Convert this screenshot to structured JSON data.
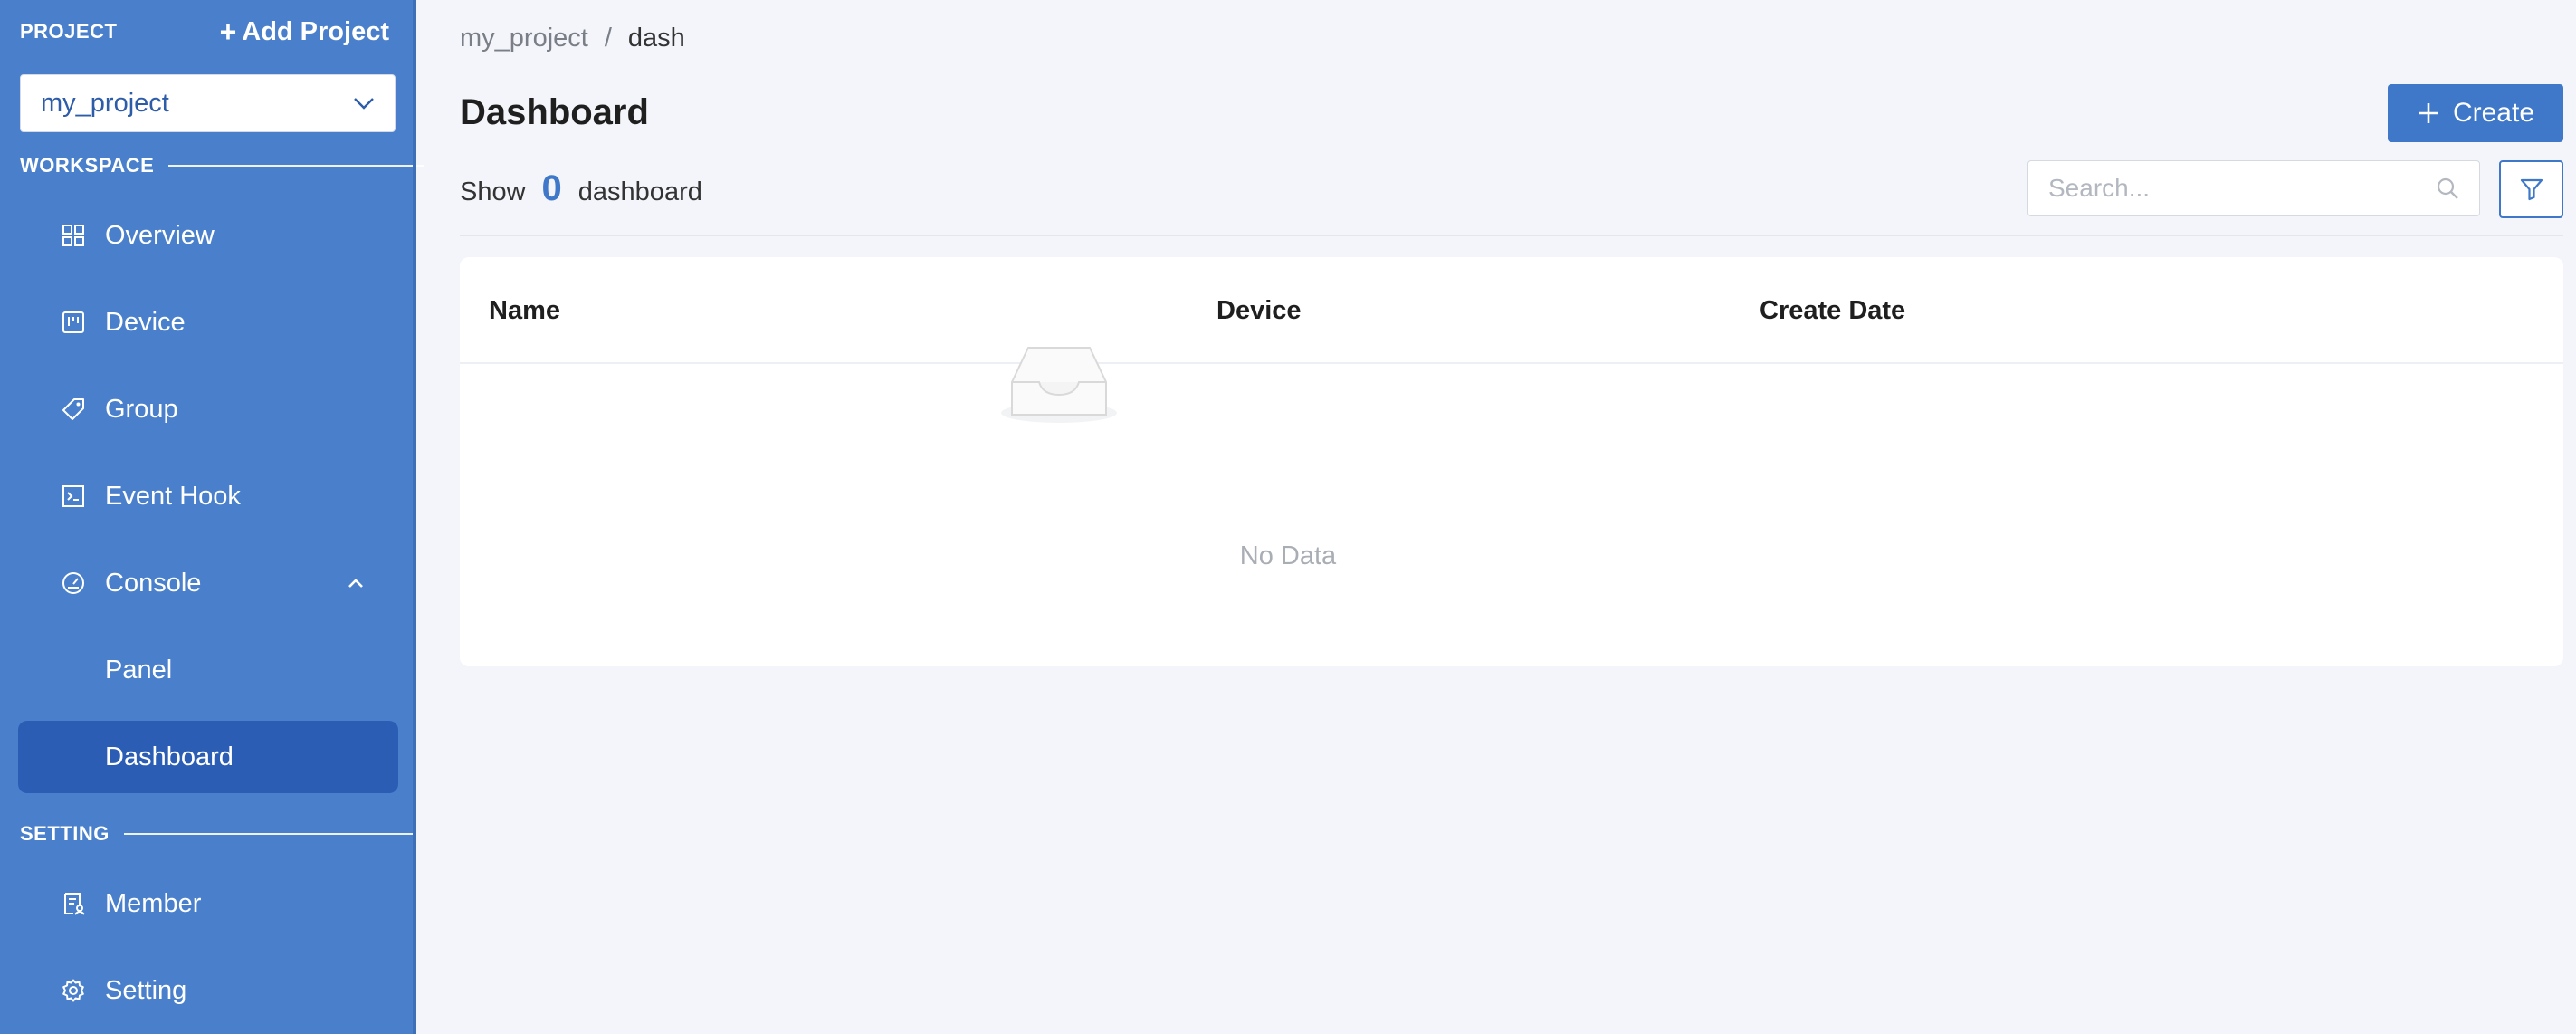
{
  "sidebar": {
    "project_title": "PROJECT",
    "add_project_label": "Add Project",
    "selected_project": "my_project",
    "workspace_label": "WORKSPACE",
    "setting_label": "SETTING",
    "nav": {
      "overview": "Overview",
      "device": "Device",
      "group": "Group",
      "event_hook": "Event Hook",
      "console": "Console",
      "panel": "Panel",
      "dashboard": "Dashboard",
      "member": "Member",
      "setting": "Setting"
    },
    "colors": {
      "background": "#4a80cb",
      "active": "#2b5db5"
    }
  },
  "breadcrumb": {
    "root": "my_project",
    "separator": "/",
    "current": "dash"
  },
  "main": {
    "title": "Dashboard",
    "create_label": "Create",
    "show_label": "Show",
    "count": "0",
    "count_unit": "dashboard",
    "search_placeholder": "Search...",
    "accent": "#3f78c8"
  },
  "table": {
    "columns": [
      "Name",
      "Device",
      "Create Date"
    ],
    "rows": [],
    "empty_text": "No Data"
  }
}
